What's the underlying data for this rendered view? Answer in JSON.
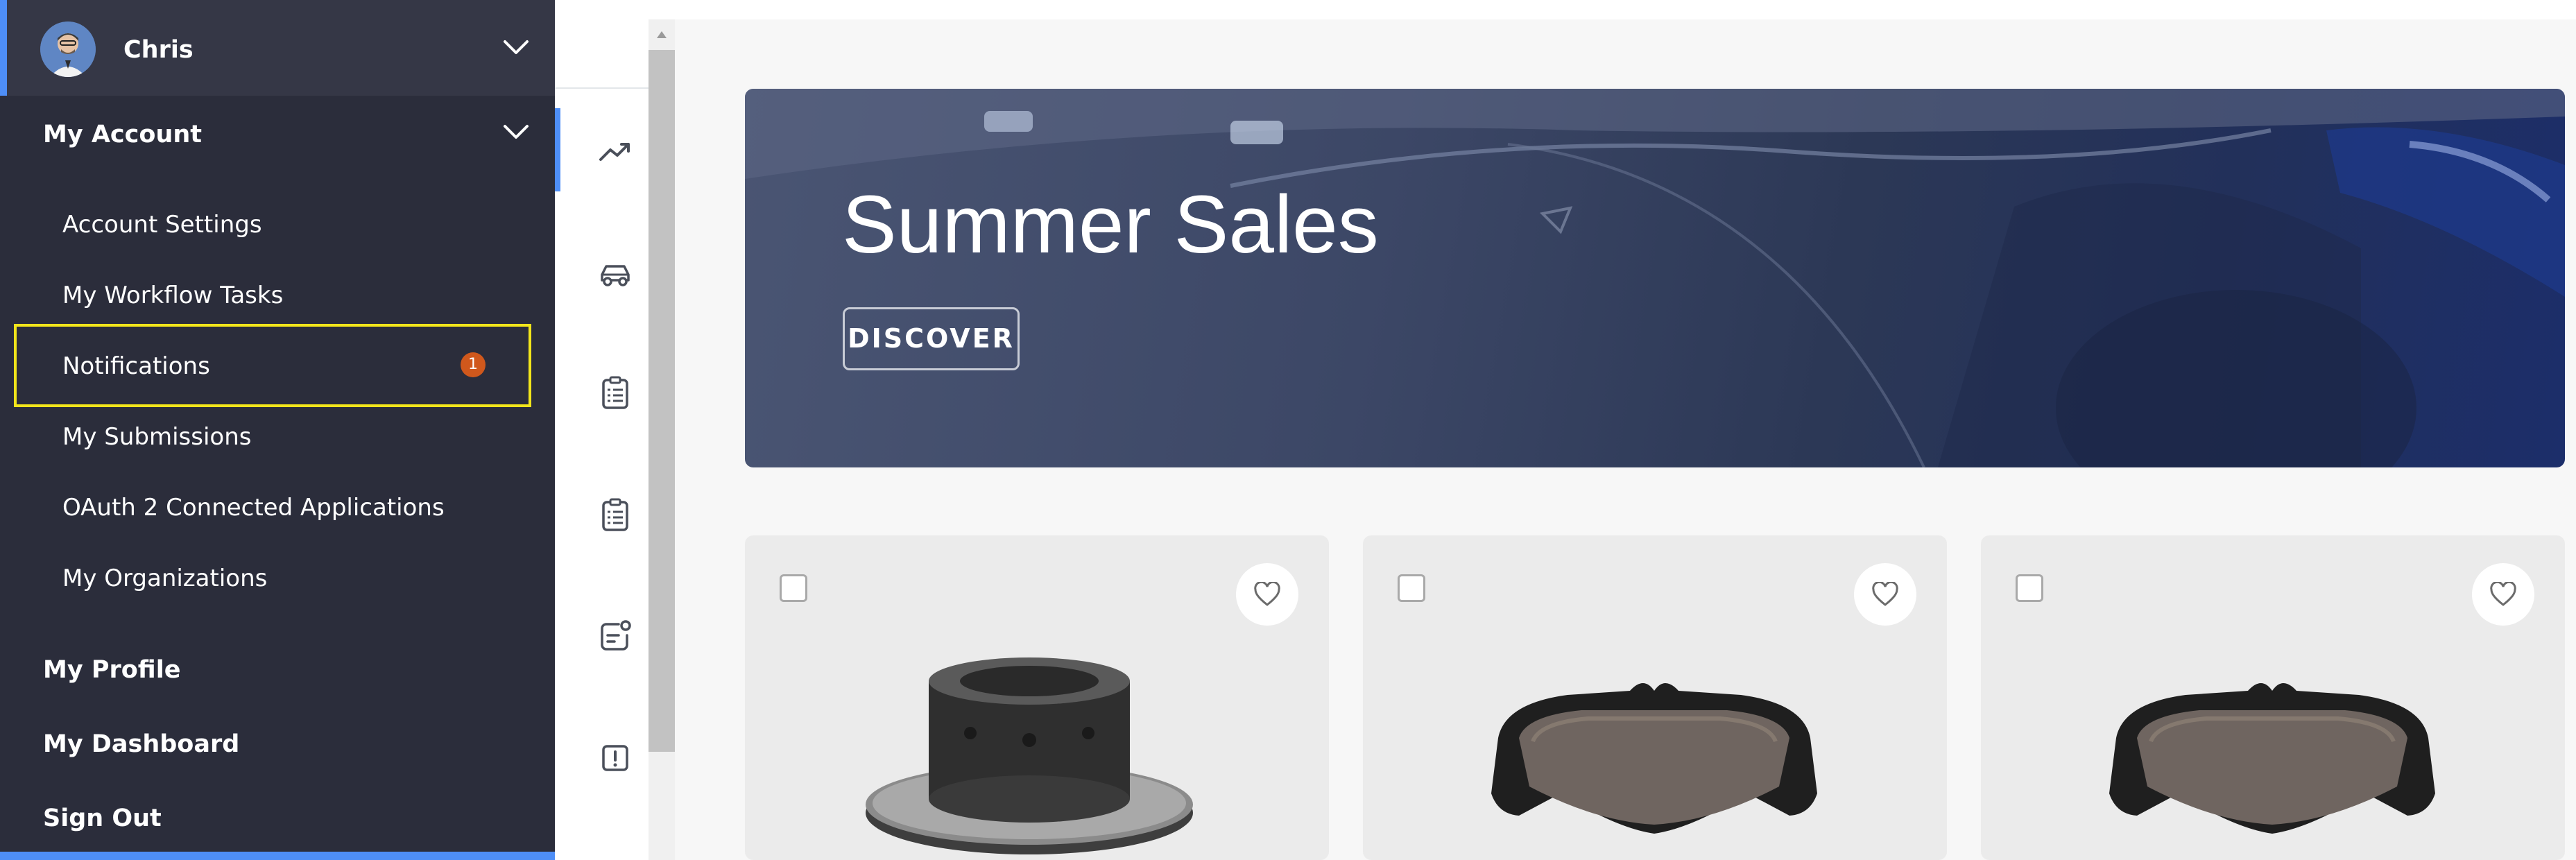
{
  "user": {
    "name": "Chris"
  },
  "sidebar": {
    "account_section": "My Account",
    "items": [
      {
        "label": "Account Settings"
      },
      {
        "label": "My Workflow Tasks"
      },
      {
        "label": "Notifications",
        "badge": "1"
      },
      {
        "label": "My Submissions"
      },
      {
        "label": "OAuth 2 Connected Applications"
      },
      {
        "label": "My Organizations"
      }
    ],
    "profile": "My Profile",
    "dashboard": "My Dashboard",
    "sign_out": "Sign Out"
  },
  "rail": {
    "icons": [
      "trend-up-icon",
      "car-icon",
      "checklist-icon",
      "checklist-icon",
      "task-notification-icon",
      "alert-icon"
    ]
  },
  "banner": {
    "title": "Summer Sales",
    "button": "DISCOVER"
  },
  "products": [
    {
      "image": "brake-disc",
      "favorite": false,
      "selected": false
    },
    {
      "image": "brake-pads",
      "favorite": false,
      "selected": false
    },
    {
      "image": "brake-pads",
      "favorite": false,
      "selected": false
    }
  ],
  "colors": {
    "sidebar_bg": "#2b2d3b",
    "accent": "#4e8ef7",
    "highlight": "#f2e51b",
    "badge": "#d0581c"
  }
}
